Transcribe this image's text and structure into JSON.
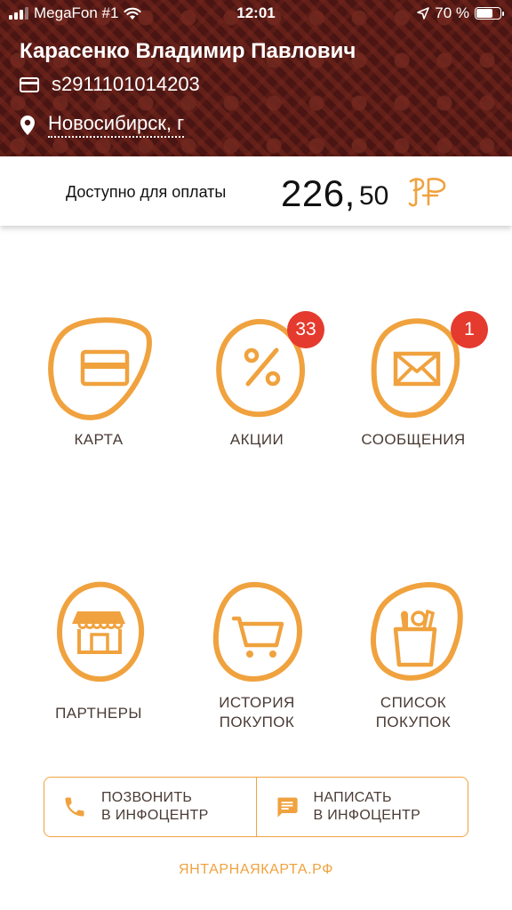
{
  "status_bar": {
    "carrier": "MegaFon #1",
    "time": "12:01",
    "battery": "70 %",
    "battery_level": 0.7
  },
  "header": {
    "user_name": "Карасенко Владимир Павлович",
    "card_number": "s2911101014203",
    "city": "Новосибирск, г"
  },
  "balance": {
    "label": "Доступно для оплаты",
    "integer": "226,",
    "fraction": "50",
    "currency_icon": "amber-ruble-logo-icon"
  },
  "menu": {
    "card": {
      "label": "КАРТА",
      "icon": "card-icon"
    },
    "promos": {
      "label": "АКЦИИ",
      "icon": "percent-icon",
      "badge": "33"
    },
    "messages": {
      "label": "СООБЩЕНИЯ",
      "icon": "envelope-icon",
      "badge": "1"
    },
    "partners": {
      "label": "ПАРТНЕРЫ",
      "icon": "store-icon"
    },
    "history": {
      "line1": "ИСТОРИЯ",
      "line2": "ПОКУПОК",
      "icon": "cart-icon"
    },
    "shopping_list": {
      "line1": "СПИСОК",
      "line2": "ПОКУПОК",
      "icon": "grocery-bag-icon"
    }
  },
  "actions": {
    "call": {
      "line1": "ПОЗВОНИТЬ",
      "line2": "В ИНФОЦЕНТР",
      "icon": "phone-icon"
    },
    "write": {
      "line1": "НАПИСАТЬ",
      "line2": "В ИНФОЦЕНТР",
      "icon": "chat-icon"
    }
  },
  "footer": {
    "link": "ЯНТАРНАЯКАРТА.РФ"
  },
  "colors": {
    "accent": "#f0a23e",
    "header_bg": "#4a1512",
    "badge": "#e53a2e",
    "label_text": "#4a3b35"
  }
}
